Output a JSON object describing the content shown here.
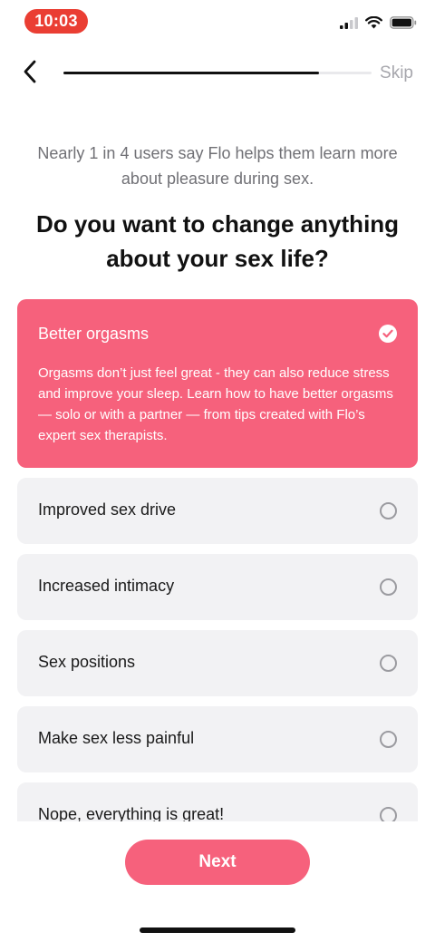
{
  "status_bar": {
    "time": "10:03",
    "time_pill_color": "#ea3e33",
    "icons": [
      "cellular-signal-icon",
      "wifi-icon",
      "battery-icon"
    ]
  },
  "nav": {
    "back_icon": "chevron-left-icon",
    "progress_fraction": 0.83,
    "skip_label": "Skip"
  },
  "subtitle": "Nearly 1 in 4 users say Flo helps them learn more about pleasure during sex.",
  "question": "Do you want to change anything about your sex life?",
  "options": [
    {
      "label": "Better orgasms",
      "selected": true,
      "description": "Orgasms don’t just feel great - they can also reduce stress and improve your sleep. Learn how to have better orgasms — solo or with a partner — from tips created with Flo’s expert sex therapists."
    },
    {
      "label": "Improved sex drive",
      "selected": false
    },
    {
      "label": "Increased intimacy",
      "selected": false
    },
    {
      "label": "Sex positions",
      "selected": false
    },
    {
      "label": "Make sex less painful",
      "selected": false
    },
    {
      "label": "Nope, everything is great!",
      "selected": false
    }
  ],
  "next_label": "Next",
  "colors": {
    "accent": "#f6617c",
    "option_bg": "#f2f2f4",
    "text_muted": "#707075"
  }
}
